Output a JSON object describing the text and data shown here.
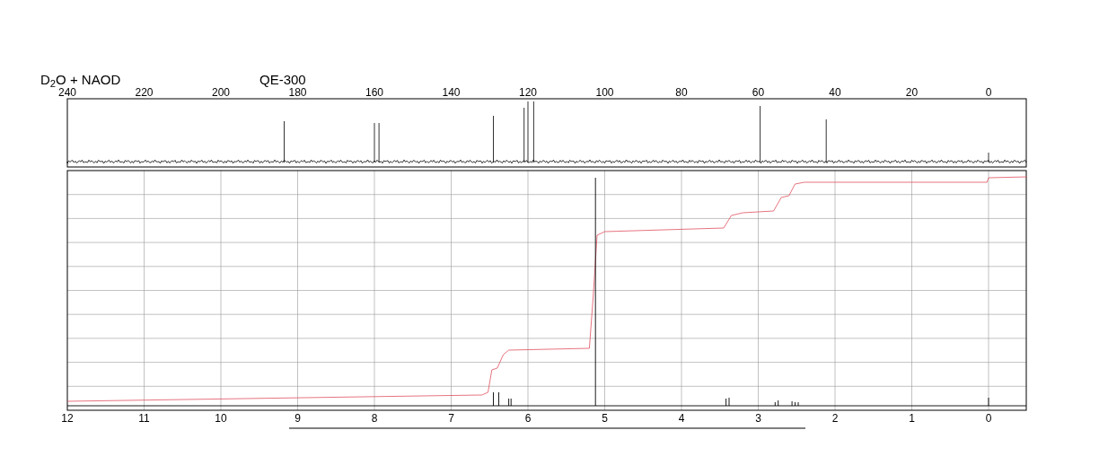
{
  "spectrum_header": {
    "solvent": "D$_{2}$O + NAOD",
    "instrument": "QE-300"
  },
  "carbon_axis": {
    "ticks": [
      "240",
      "220",
      "200",
      "180",
      "160",
      "140",
      "120",
      "100",
      "80",
      "60",
      "40",
      "20",
      "0"
    ]
  },
  "proton_axis": {
    "ticks": [
      "12",
      "11",
      "10",
      "9",
      "8",
      "7",
      "6",
      "5",
      "4",
      "3",
      "2",
      "1",
      "0"
    ]
  }
}
